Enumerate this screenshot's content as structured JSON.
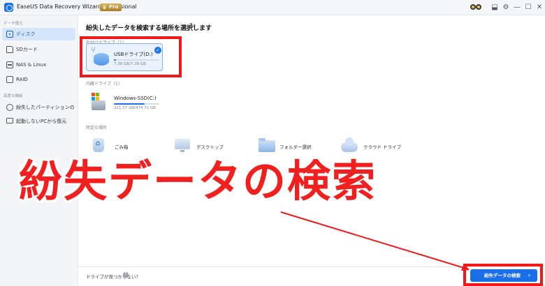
{
  "window": {
    "title": "EaseUS Data Recovery Wizard Professional",
    "badge": "Pro",
    "controls": [
      "⬓",
      "⚙",
      "—",
      "☐",
      "✕"
    ]
  },
  "sidebar": {
    "section1": "データ復元",
    "section2": "高度な機能",
    "items": [
      {
        "label": "ディスク",
        "icon": "disk-icon",
        "active": true
      },
      {
        "label": "SDカード",
        "icon": "sd-card-icon",
        "active": false
      },
      {
        "label": "NAS & Linux",
        "icon": "nas-icon",
        "active": false
      },
      {
        "label": "RAID",
        "icon": "raid-icon",
        "active": false
      },
      {
        "label": "紛失したパーティションのレスキュー",
        "icon": "partition-icon",
        "active": false
      },
      {
        "label": "起動しないPCから復元",
        "icon": "pc-icon",
        "active": false
      }
    ]
  },
  "main": {
    "title": "紛失したデータを検索する場所を選択します",
    "external_group": "外付けドライブ（1）",
    "internal_group": "内蔵ドライブ（1）",
    "location_group": "特定の場所",
    "drives": [
      {
        "name": "USBドライブ(D:)",
        "size": "7.38 GB/7.38 GB",
        "used_fraction": 0.04,
        "selected": true
      },
      {
        "name": "Windows-SSD(C:)",
        "size": "321.37 GB/474.72 GB",
        "used_fraction": 0.68,
        "selected": false
      }
    ],
    "locations": [
      {
        "label": "ごみ箱",
        "icon": "recycle-bin-icon"
      },
      {
        "label": "デスクトップ",
        "icon": "desktop-icon"
      },
      {
        "label": "フォルダー選択",
        "icon": "folder-icon"
      },
      {
        "label": "クラウド ドライブ",
        "icon": "cloud-icon"
      }
    ]
  },
  "footer": {
    "help_text": "ドライブが見つからない?",
    "scan_button": "紛失データの検索"
  },
  "overlay": {
    "caption": "紛失データの検索",
    "highlight_color": "#f01818"
  }
}
